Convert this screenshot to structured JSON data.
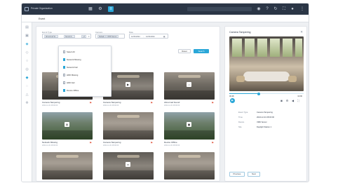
{
  "topbar": {
    "site_name": "Private Organization",
    "search_placeholder": "",
    "colors": {
      "bar": "#2b3646",
      "accent": "#2aa7d8"
    }
  },
  "subheader": {
    "title": "Event"
  },
  "nav": {
    "icons": [
      "grid-icon",
      "camera-icon",
      "event-icon",
      "map-icon",
      "user-icon",
      "people-icon",
      "shield-icon",
      "bell-icon",
      "alert-icon",
      "settings-icon"
    ]
  },
  "filters": {
    "event_type_label": "Event Type",
    "event_type_chips": [
      "Abnormal Sc...",
      "Sound A..."
    ],
    "event_type_more": "+3",
    "camera_label": "Camera",
    "camera_chips": [
      "Default",
      "VMD Server"
    ],
    "date_label": "Date",
    "date_from": "12/31/2024",
    "date_to": "12/31/2024",
    "reset_label": "Reset",
    "search_label": "Search"
  },
  "dropdown": {
    "items": [
      {
        "label": "Select All",
        "checked": false
      },
      {
        "label": "Network Missing",
        "checked": true
      },
      {
        "label": "Network Fail",
        "checked": true
      },
      {
        "label": "HDD Missing",
        "checked": false
      },
      {
        "label": "HDD Fail",
        "checked": false
      },
      {
        "label": "Device Offline",
        "checked": true
      }
    ]
  },
  "cards": [
    {
      "title": "Camera Tampering",
      "time": "2024-12-31 08:00:00"
    },
    {
      "title": "Camera Tampering",
      "time": "2024-12-31 08:00:00"
    },
    {
      "title": "Abnormal Sound",
      "time": "2024-12-31 08:00:00"
    },
    {
      "title": "Network Missing",
      "time": "2024-12-31 08:00:00"
    },
    {
      "title": "Camera Tampering",
      "time": "2024-12-31 08:00:00"
    },
    {
      "title": "Device Offline",
      "time": "2024-12-31 08:00:00"
    },
    {
      "title": "",
      "time": ""
    },
    {
      "title": "",
      "time": ""
    },
    {
      "title": "",
      "time": ""
    }
  ],
  "detail": {
    "title": "Camera Tampering",
    "time_start": "00:48",
    "time_end": "02:00",
    "progress": 0.4,
    "info": [
      {
        "label": "Event Type",
        "value": "Camera Tampering"
      },
      {
        "label": "Time",
        "value": "2024-12-31 08:00:00"
      },
      {
        "label": "Device",
        "value": "VMD Server"
      },
      {
        "label": "Site",
        "value": "Daylight Station 1"
      }
    ],
    "prev_label": "Previous",
    "next_label": "Next"
  }
}
